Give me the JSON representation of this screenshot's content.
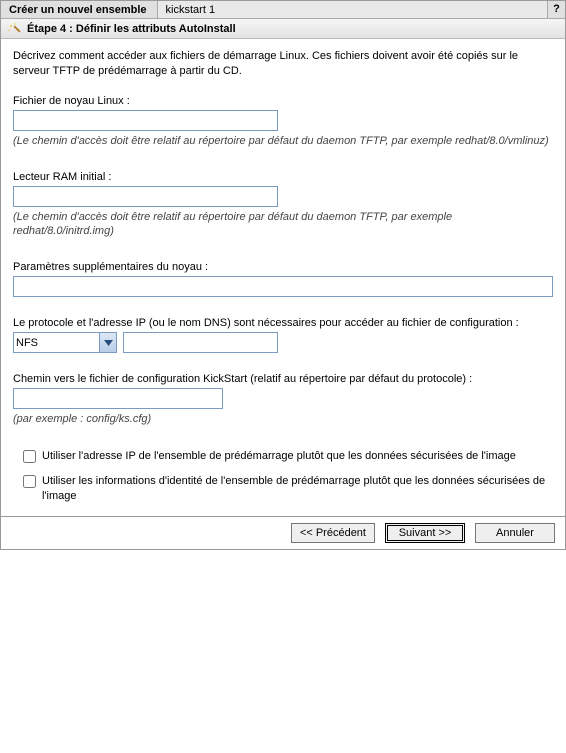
{
  "titlebar": {
    "tab": "Créer un nouvel ensemble",
    "subtitle": "kickstart 1",
    "help": "?"
  },
  "step": {
    "label": "Étape 4 : Définir les attributs AutoInstall"
  },
  "description": "Décrivez comment accéder aux fichiers de démarrage Linux. Ces fichiers doivent avoir été copiés sur le serveur TFTP de prédémarrage à partir du CD.",
  "kernel": {
    "label": "Fichier de noyau Linux :",
    "value": "",
    "hint": "(Le chemin d'accès doit être relatif au répertoire par défaut du daemon TFTP, par exemple redhat/8.0/vmlinuz)"
  },
  "initrd": {
    "label": "Lecteur RAM initial :",
    "value": "",
    "hint": "(Le chemin d'accès doit être relatif au répertoire par défaut du daemon TFTP, par exemple redhat/8.0/initrd.img)"
  },
  "kparams": {
    "label": "Paramètres supplémentaires du noyau :",
    "value": ""
  },
  "protocol": {
    "label": "Le protocole et l'adresse IP (ou le nom DNS) sont nécessaires pour accéder au fichier de configuration :",
    "selected": "NFS",
    "address": ""
  },
  "cfgpath": {
    "label": "Chemin vers le fichier de configuration KickStart (relatif au répertoire par défaut du protocole) :",
    "value": "",
    "hint": "(par exemple : config/ks.cfg)"
  },
  "checks": {
    "use_ip": "Utiliser l'adresse IP de l'ensemble de prédémarrage plutôt que les données sécurisées de l'image",
    "use_identity": "Utiliser les informations d'identité de l'ensemble de prédémarrage plutôt que les données sécurisées de l'image"
  },
  "buttons": {
    "prev": "<< Précédent",
    "next": "Suivant >>",
    "cancel": "Annuler"
  }
}
